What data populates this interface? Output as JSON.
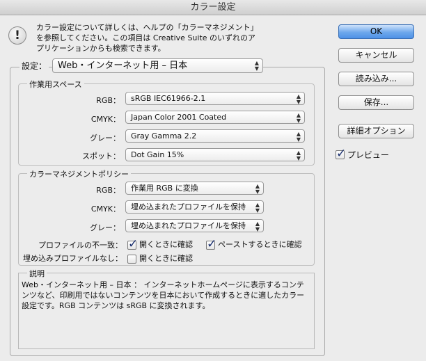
{
  "window": {
    "title": "カラー設定"
  },
  "info": {
    "text": "カラー設定について詳しくは、ヘルプの「カラーマネジメント」を参照してください。この項目は Creative Suite のいずれのアプリケーションからも検索できます。"
  },
  "buttons": {
    "ok": "OK",
    "cancel": "キャンセル",
    "load": "読み込み...",
    "save": "保存...",
    "advanced": "詳細オプション"
  },
  "preview": {
    "label": "プレビュー",
    "checked": true
  },
  "settings": {
    "label": "設定：",
    "value": "Web・インターネット用 – 日本"
  },
  "workspace": {
    "title": "作業用スペース",
    "rgb": {
      "label": "RGB：",
      "value": "sRGB IEC61966-2.1"
    },
    "cmyk": {
      "label": "CMYK：",
      "value": "Japan Color 2001 Coated"
    },
    "gray": {
      "label": "グレー：",
      "value": "Gray Gamma 2.2"
    },
    "spot": {
      "label": "スポット：",
      "value": "Dot Gain 15%"
    }
  },
  "policy": {
    "title": "カラーマネジメントポリシー",
    "rgb": {
      "label": "RGB：",
      "value": "作業用 RGB に変換"
    },
    "cmyk": {
      "label": "CMYK：",
      "value": "埋め込まれたプロファイルを保持"
    },
    "gray": {
      "label": "グレー：",
      "value": "埋め込まれたプロファイルを保持"
    },
    "mismatch": {
      "label": "プロファイルの不一致：",
      "on_open": {
        "label": "開くときに確認",
        "checked": true
      },
      "on_paste": {
        "label": "ペーストするときに確認",
        "checked": true
      }
    },
    "missing": {
      "label": "埋め込みプロファイルなし：",
      "on_open": {
        "label": "開くときに確認",
        "checked": false
      }
    }
  },
  "description": {
    "title": "説明",
    "text": "Web・インターネット用 – 日本 ： インターネットホームページに表示するコンテンツなど、印刷用ではないコンテンツを日本において作成するときに適したカラー設定です。RGB コンテンツは sRGB に変換されます。"
  }
}
